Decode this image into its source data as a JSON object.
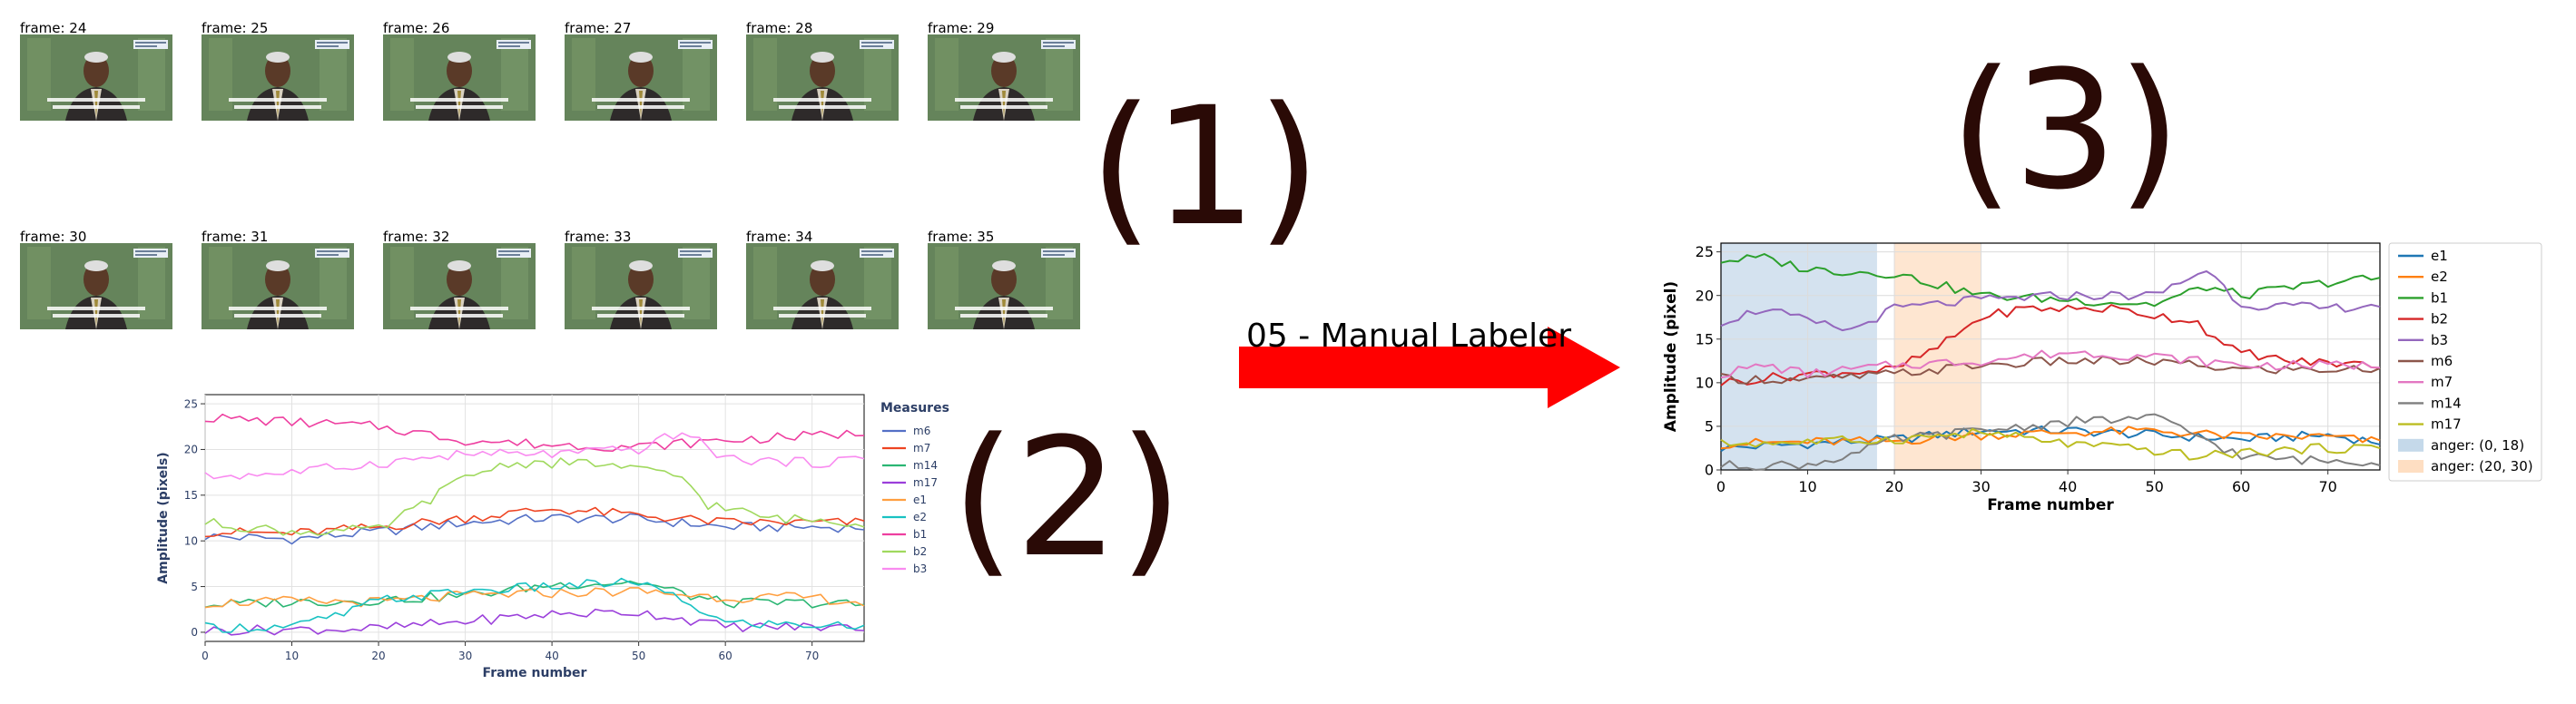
{
  "steps": [
    "(1)",
    "(2)",
    "(3)"
  ],
  "arrow": {
    "label": "05 - Manual Labeler",
    "color": "#ff0000"
  },
  "frames": [
    {
      "label": "frame: 24"
    },
    {
      "label": "frame: 25"
    },
    {
      "label": "frame: 26"
    },
    {
      "label": "frame: 27"
    },
    {
      "label": "frame: 28"
    },
    {
      "label": "frame: 29"
    },
    {
      "label": "frame: 30"
    },
    {
      "label": "frame: 31"
    },
    {
      "label": "frame: 32"
    },
    {
      "label": "frame: 33"
    },
    {
      "label": "frame: 34"
    },
    {
      "label": "frame: 35"
    }
  ],
  "chart_data": [
    {
      "type": "line",
      "title": "",
      "xlabel": "Frame number",
      "ylabel": "Amplitude (pixels)",
      "xlim": [
        0,
        76
      ],
      "ylim": [
        -1,
        26
      ],
      "xticks": [
        0,
        10,
        20,
        30,
        40,
        50,
        60,
        70
      ],
      "yticks": [
        0,
        5,
        10,
        15,
        20,
        25
      ],
      "grid": true,
      "legend_title": "Measures",
      "legend_placement": "right",
      "series": [
        {
          "name": "m6",
          "color": "#5470c6",
          "anchors": [
            [
              0,
              10.5
            ],
            [
              10,
              10.2
            ],
            [
              20,
              11
            ],
            [
              30,
              12
            ],
            [
              40,
              12.5
            ],
            [
              50,
              12.4
            ],
            [
              60,
              11.5
            ],
            [
              70,
              11.5
            ],
            [
              76,
              11.5
            ]
          ]
        },
        {
          "name": "m7",
          "color": "#ee4422",
          "anchors": [
            [
              0,
              11
            ],
            [
              10,
              10.8
            ],
            [
              20,
              11.5
            ],
            [
              30,
              12.5
            ],
            [
              40,
              13.5
            ],
            [
              50,
              12.8
            ],
            [
              60,
              12
            ],
            [
              70,
              12
            ],
            [
              76,
              12
            ]
          ]
        },
        {
          "name": "m14",
          "color": "#2bb673",
          "anchors": [
            [
              0,
              3
            ],
            [
              10,
              3.3
            ],
            [
              20,
              3.5
            ],
            [
              30,
              4
            ],
            [
              40,
              5.2
            ],
            [
              50,
              5.5
            ],
            [
              56,
              4
            ],
            [
              60,
              3.2
            ],
            [
              70,
              3.2
            ],
            [
              76,
              3
            ]
          ]
        },
        {
          "name": "m17",
          "color": "#9b3fdb",
          "anchors": [
            [
              0,
              0.2
            ],
            [
              10,
              0.3
            ],
            [
              20,
              0.4
            ],
            [
              30,
              1.2
            ],
            [
              40,
              2
            ],
            [
              50,
              2.2
            ],
            [
              55,
              1.5
            ],
            [
              60,
              0.6
            ],
            [
              70,
              0.6
            ],
            [
              76,
              0.5
            ]
          ]
        },
        {
          "name": "e1",
          "color": "#ff9f40",
          "anchors": [
            [
              0,
              3.2
            ],
            [
              10,
              3.4
            ],
            [
              20,
              3.3
            ],
            [
              30,
              4
            ],
            [
              40,
              4.3
            ],
            [
              50,
              4.5
            ],
            [
              60,
              3.8
            ],
            [
              70,
              3.8
            ],
            [
              76,
              3.2
            ]
          ]
        },
        {
          "name": "e2",
          "color": "#19c2c2",
          "anchors": [
            [
              0,
              0.5
            ],
            [
              10,
              0.6
            ],
            [
              16,
              2
            ],
            [
              20,
              3.5
            ],
            [
              30,
              4.5
            ],
            [
              40,
              5
            ],
            [
              50,
              5.5
            ],
            [
              56,
              3
            ],
            [
              60,
              1
            ],
            [
              70,
              0.8
            ],
            [
              76,
              0.6
            ]
          ]
        },
        {
          "name": "b1",
          "color": "#ee3fa0",
          "anchors": [
            [
              0,
              23.5
            ],
            [
              10,
              23
            ],
            [
              20,
              22.5
            ],
            [
              30,
              21
            ],
            [
              40,
              20.5
            ],
            [
              50,
              20.3
            ],
            [
              60,
              21
            ],
            [
              70,
              21.5
            ],
            [
              76,
              21.8
            ]
          ]
        },
        {
          "name": "b2",
          "color": "#a0d95e",
          "anchors": [
            [
              0,
              12
            ],
            [
              10,
              11
            ],
            [
              20,
              11.2
            ],
            [
              25,
              14
            ],
            [
              30,
              17
            ],
            [
              35,
              18.5
            ],
            [
              45,
              18.5
            ],
            [
              55,
              17
            ],
            [
              58,
              14
            ],
            [
              65,
              12.5
            ],
            [
              76,
              12
            ]
          ]
        },
        {
          "name": "b3",
          "color": "#f98bf0",
          "anchors": [
            [
              0,
              17
            ],
            [
              10,
              17.5
            ],
            [
              20,
              18.5
            ],
            [
              30,
              19.5
            ],
            [
              40,
              19.5
            ],
            [
              50,
              20
            ],
            [
              55,
              22
            ],
            [
              60,
              19
            ],
            [
              70,
              18.5
            ],
            [
              76,
              19
            ]
          ]
        }
      ]
    },
    {
      "type": "line",
      "title": "",
      "xlabel": "Frame number",
      "ylabel": "Amplitude (pixel)",
      "xlim": [
        0,
        76
      ],
      "ylim": [
        0,
        26
      ],
      "xticks": [
        0,
        10,
        20,
        30,
        40,
        50,
        60,
        70
      ],
      "yticks": [
        0,
        5,
        10,
        15,
        20,
        25
      ],
      "grid": true,
      "legend_placement": "right",
      "regions": [
        {
          "name": "anger: (0, 18)",
          "x": [
            0,
            18
          ],
          "color": "#9fbfdc"
        },
        {
          "name": "anger: (20, 30)",
          "x": [
            20,
            30
          ],
          "color": "#fdc89a"
        }
      ],
      "series": [
        {
          "name": "e1",
          "color": "#1f77b4",
          "anchors": [
            [
              0,
              2.5
            ],
            [
              10,
              3
            ],
            [
              20,
              3.5
            ],
            [
              30,
              4.5
            ],
            [
              40,
              4.5
            ],
            [
              50,
              4
            ],
            [
              60,
              3.5
            ],
            [
              70,
              4
            ],
            [
              76,
              3.2
            ]
          ]
        },
        {
          "name": "e2",
          "color": "#ff7f0e",
          "anchors": [
            [
              0,
              3
            ],
            [
              10,
              3.2
            ],
            [
              20,
              3.3
            ],
            [
              30,
              4
            ],
            [
              40,
              4.3
            ],
            [
              50,
              4.5
            ],
            [
              60,
              3.8
            ],
            [
              70,
              3.8
            ],
            [
              76,
              3.2
            ]
          ]
        },
        {
          "name": "b1",
          "color": "#2ca02c",
          "anchors": [
            [
              0,
              24
            ],
            [
              5,
              24.3
            ],
            [
              10,
              23
            ],
            [
              20,
              22.5
            ],
            [
              30,
              20
            ],
            [
              40,
              19.5
            ],
            [
              50,
              19
            ],
            [
              56,
              21
            ],
            [
              60,
              20
            ],
            [
              70,
              21.5
            ],
            [
              76,
              22
            ]
          ]
        },
        {
          "name": "b2",
          "color": "#d62728",
          "anchors": [
            [
              0,
              10
            ],
            [
              10,
              11
            ],
            [
              20,
              11.5
            ],
            [
              25,
              14
            ],
            [
              30,
              17.5
            ],
            [
              35,
              18.5
            ],
            [
              45,
              18.5
            ],
            [
              55,
              17
            ],
            [
              58,
              14
            ],
            [
              65,
              12.5
            ],
            [
              76,
              12
            ]
          ]
        },
        {
          "name": "b3",
          "color": "#9467bd",
          "anchors": [
            [
              0,
              17
            ],
            [
              5,
              18.5
            ],
            [
              10,
              17
            ],
            [
              15,
              16
            ],
            [
              20,
              18.5
            ],
            [
              30,
              19.5
            ],
            [
              40,
              20
            ],
            [
              50,
              20
            ],
            [
              56,
              23
            ],
            [
              60,
              19
            ],
            [
              70,
              18.5
            ],
            [
              76,
              19
            ]
          ]
        },
        {
          "name": "m6",
          "color": "#8c564b",
          "anchors": [
            [
              0,
              10.5
            ],
            [
              10,
              10.3
            ],
            [
              20,
              11
            ],
            [
              30,
              12
            ],
            [
              40,
              12.5
            ],
            [
              50,
              12.4
            ],
            [
              60,
              11.5
            ],
            [
              70,
              11.5
            ],
            [
              76,
              11.5
            ]
          ]
        },
        {
          "name": "m7",
          "color": "#e377c2",
          "anchors": [
            [
              0,
              11
            ],
            [
              5,
              12
            ],
            [
              10,
              11
            ],
            [
              20,
              12
            ],
            [
              30,
              12.5
            ],
            [
              40,
              13.5
            ],
            [
              50,
              13
            ],
            [
              60,
              12
            ],
            [
              70,
              12
            ],
            [
              76,
              12
            ]
          ]
        },
        {
          "name": "m14",
          "color": "#7f7f7f",
          "anchors": [
            [
              0,
              0.5
            ],
            [
              10,
              0.6
            ],
            [
              16,
              2
            ],
            [
              20,
              3.5
            ],
            [
              30,
              4.5
            ],
            [
              40,
              5.5
            ],
            [
              50,
              6
            ],
            [
              56,
              3.5
            ],
            [
              60,
              1.5
            ],
            [
              70,
              1
            ],
            [
              76,
              1
            ]
          ]
        },
        {
          "name": "m17",
          "color": "#bcbd22",
          "anchors": [
            [
              0,
              3
            ],
            [
              10,
              3.2
            ],
            [
              20,
              3.5
            ],
            [
              30,
              4.3
            ],
            [
              40,
              3
            ],
            [
              50,
              2.2
            ],
            [
              55,
              1.5
            ],
            [
              60,
              2
            ],
            [
              70,
              2.5
            ],
            [
              76,
              2.5
            ]
          ]
        }
      ]
    }
  ]
}
